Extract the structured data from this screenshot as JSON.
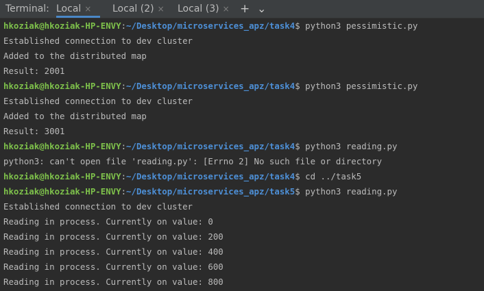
{
  "tabbar": {
    "title": "Terminal:",
    "tabs": [
      {
        "label": "Local",
        "close": "×"
      },
      {
        "label": "Local (2)",
        "close": "×"
      },
      {
        "label": "Local (3)",
        "close": "×"
      }
    ],
    "add_icon": "+",
    "more_icon": "⌄"
  },
  "colors": {
    "user": "#7ec14b",
    "path": "#4d8fd6",
    "text": "#bbbbbb",
    "background": "#2b2b2b",
    "active_tab_underline": "#4a88c7"
  },
  "terminal": {
    "lines": [
      {
        "user": "hkoziak@hkoziak-HP-ENVY",
        "colon": ":",
        "path": "~/Desktop/microservices_apz/task4",
        "dollar": "$",
        "cmd": " python3 pessimistic.py"
      },
      {
        "text": "Established connection to dev cluster"
      },
      {
        "text": "Added to the distributed map"
      },
      {
        "text": "Result: 2001"
      },
      {
        "user": "hkoziak@hkoziak-HP-ENVY",
        "colon": ":",
        "path": "~/Desktop/microservices_apz/task4",
        "dollar": "$",
        "cmd": " python3 pessimistic.py"
      },
      {
        "text": "Established connection to dev cluster"
      },
      {
        "text": "Added to the distributed map"
      },
      {
        "text": "Result: 3001"
      },
      {
        "user": "hkoziak@hkoziak-HP-ENVY",
        "colon": ":",
        "path": "~/Desktop/microservices_apz/task4",
        "dollar": "$",
        "cmd": " python3 reading.py"
      },
      {
        "text": "python3: can't open file 'reading.py': [Errno 2] No such file or directory"
      },
      {
        "user": "hkoziak@hkoziak-HP-ENVY",
        "colon": ":",
        "path": "~/Desktop/microservices_apz/task4",
        "dollar": "$",
        "cmd": " cd ../task5"
      },
      {
        "user": "hkoziak@hkoziak-HP-ENVY",
        "colon": ":",
        "path": "~/Desktop/microservices_apz/task5",
        "dollar": "$",
        "cmd": " python3 reading.py"
      },
      {
        "text": "Established connection to dev cluster"
      },
      {
        "text": "Reading in process. Currently on value: 0"
      },
      {
        "text": "Reading in process. Currently on value: 200"
      },
      {
        "text": "Reading in process. Currently on value: 400"
      },
      {
        "text": "Reading in process. Currently on value: 600"
      },
      {
        "text": "Reading in process. Currently on value: 800"
      }
    ]
  }
}
